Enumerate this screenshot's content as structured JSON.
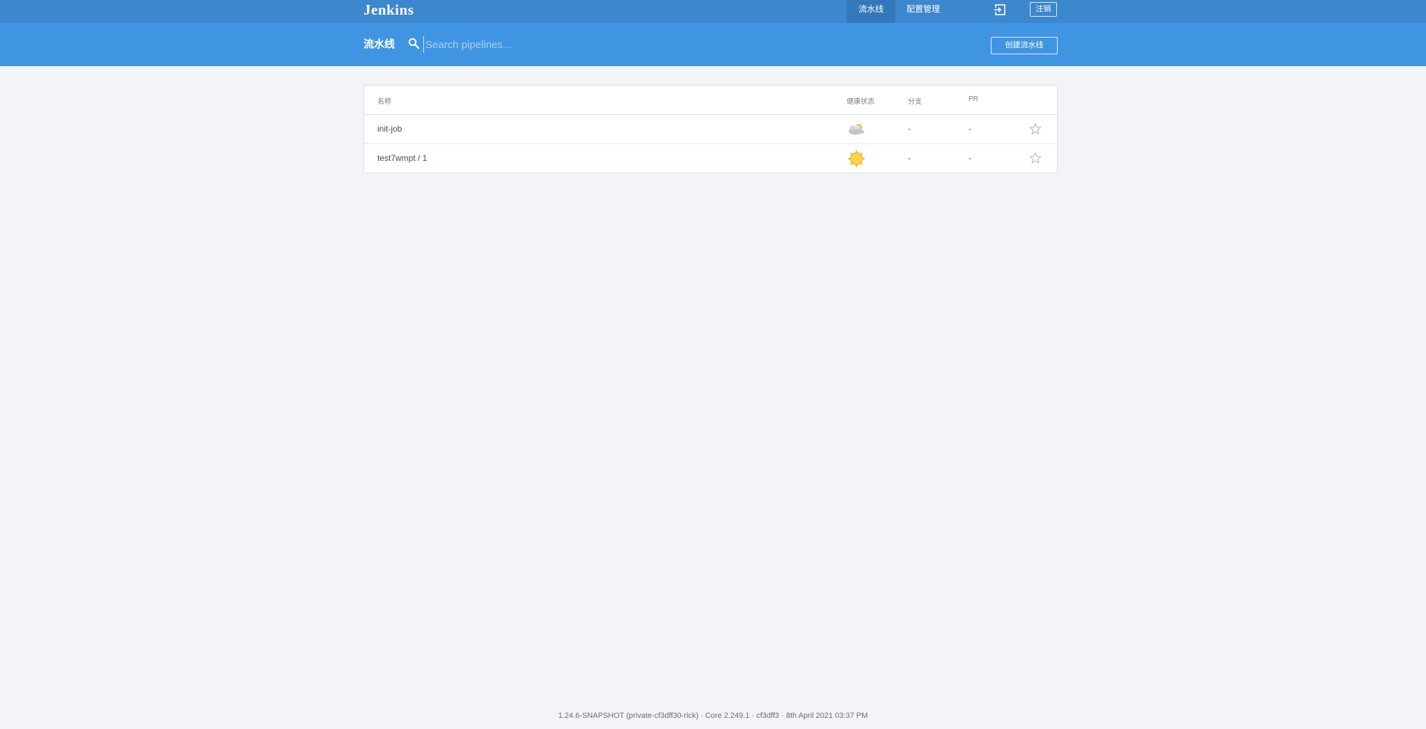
{
  "header": {
    "brand": "Jenkins",
    "tabs": [
      {
        "label": "流水线",
        "active": true
      },
      {
        "label": "配置管理",
        "active": false
      }
    ],
    "login_icon": "login-icon",
    "logout_label": "注销"
  },
  "subheader": {
    "title": "流水线",
    "search_placeholder": "Search pipelines...",
    "search_value": "",
    "create_label": "创建流水线"
  },
  "table": {
    "columns": [
      "名称",
      "健康状态",
      "分支",
      "PR"
    ],
    "rows": [
      {
        "name": "init-job",
        "health_icon": "cloudy-weather-icon",
        "branches": "-",
        "prs": "-",
        "favorite": false
      },
      {
        "name": "test7wmpt / 1",
        "health_icon": "sunny-weather-icon",
        "branches": "-",
        "prs": "-",
        "favorite": false
      }
    ]
  },
  "footer": {
    "text": "1.24.6-SNAPSHOT (private-cf3dff30-rick) · Core 2.249.1 · cf3dff3 · 8th April 2021 03:37 PM"
  },
  "colors": {
    "topbar": "#3c87cd",
    "topbar_active_tab": "#3478bb",
    "subheader": "#4095e3",
    "page_bg": "#f3f4f7"
  }
}
